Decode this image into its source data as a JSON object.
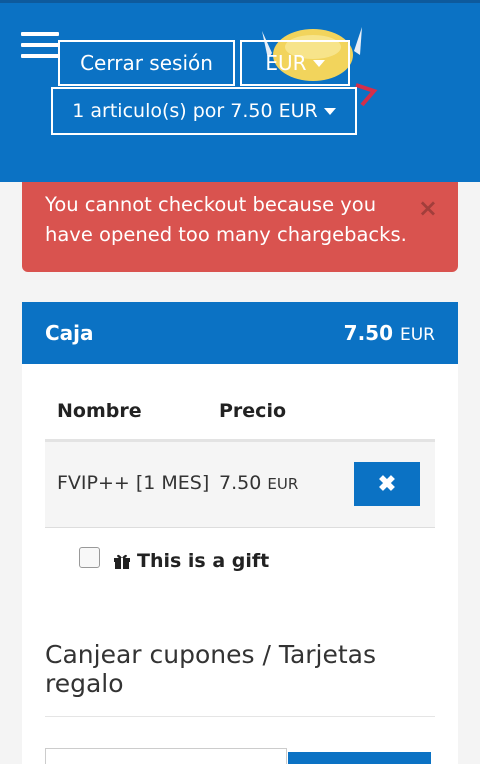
{
  "header": {
    "logout_label": "Cerrar sesión",
    "currency_label": "EUR",
    "cart_label": "1 articulo(s) por 7.50 EUR"
  },
  "alert": {
    "message": "You cannot checkout because you have opened too many chargebacks.",
    "close_symbol": "×"
  },
  "checkout": {
    "title": "Caja",
    "total_amount": "7.50",
    "total_currency": "EUR",
    "columns": {
      "name": "Nombre",
      "price": "Precio"
    },
    "items": [
      {
        "name": "FVIP++ [1 MES]",
        "price": "7.50",
        "currency": "EUR",
        "remove_symbol": "✖"
      }
    ],
    "gift_label": "This is a gift",
    "coupon_title": "Canjear cupones / Tarjetas regalo"
  },
  "colors": {
    "primary": "#0b72c4",
    "danger": "#d9534f"
  },
  "icons": [
    "menu-icon",
    "caret-down-icon",
    "close-icon",
    "remove-icon",
    "gift-icon"
  ]
}
